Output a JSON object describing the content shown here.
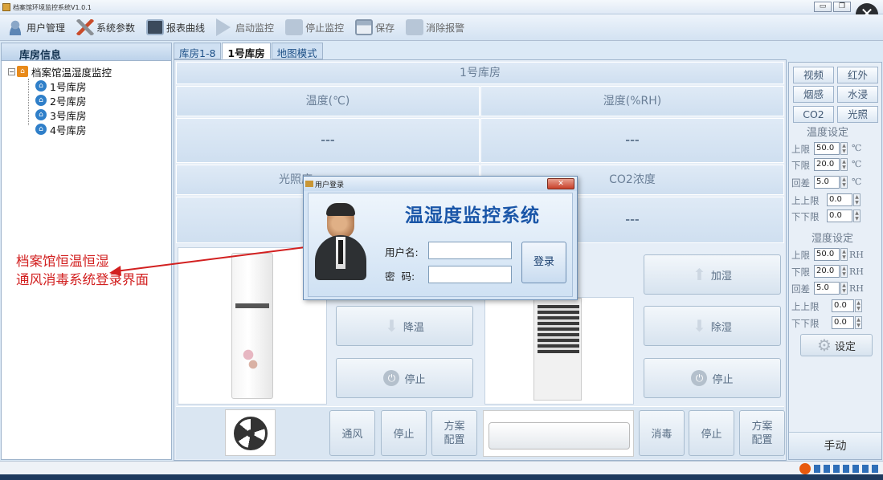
{
  "window": {
    "title": "档案馆环境监控系统V1.0.1"
  },
  "toolbar": {
    "items": [
      {
        "label": "用户管理",
        "icon": "user-icon"
      },
      {
        "label": "系统参数",
        "icon": "tools-icon"
      },
      {
        "label": "报表曲线",
        "icon": "chart-icon"
      },
      {
        "label": "启动监控",
        "icon": "play-icon"
      },
      {
        "label": "停止监控",
        "icon": "stop-icon"
      },
      {
        "label": "保存",
        "icon": "save-icon"
      },
      {
        "label": "消除报警",
        "icon": "clear-alarm-icon"
      }
    ]
  },
  "sidebar": {
    "title": "库房信息",
    "root": "档案馆温湿度监控",
    "rooms": [
      "1号库房",
      "2号库房",
      "3号库房",
      "4号库房"
    ]
  },
  "tabs": [
    "库房1-8",
    "1号库房",
    "地图模式"
  ],
  "main": {
    "room_title": "1号库房",
    "temp_label": "温度(℃)",
    "humidity_label": "湿度(%RH)",
    "temp_value": "---",
    "humidity_value": "---",
    "light_label": "光照度",
    "co2_label": "CO2浓度",
    "co2_value": "---",
    "cool_btn": "降温",
    "stop1": "停止",
    "humidify_btn": "加湿",
    "dehumidify_btn": "除湿",
    "stop2": "停止",
    "vent_btn": "通风",
    "stop3": "停止",
    "plan1": "方案\n配置",
    "disinfect_btn": "消毒",
    "stop4": "停止",
    "plan2": "方案\n配置"
  },
  "right": {
    "sensor_btns": [
      "视频",
      "红外",
      "烟感",
      "水浸",
      "CO2",
      "光照"
    ],
    "temp_set_title": "温度设定",
    "upper": "上限",
    "lower": "下限",
    "diff": "回差",
    "upper_upper": "上上限",
    "lower_lower": "下下限",
    "temp_upper": "50.0",
    "temp_lower": "20.0",
    "temp_diff": "5.0",
    "temp_uu": "0.0",
    "temp_ll": "0.0",
    "unit_c": "℃",
    "hum_set_title": "湿度设定",
    "hum_upper": "50.0",
    "hum_lower": "20.0",
    "hum_diff": "5.0",
    "hum_uu": "0.0",
    "hum_ll": "0.0",
    "unit_rh": "RH",
    "set_btn": "设定",
    "manual": "手动"
  },
  "dialog": {
    "title": "用户登录",
    "heading": "温湿度监控系统",
    "user_label": "用户名:",
    "pwd_label": "密  码:",
    "login": "登录"
  },
  "annotation": {
    "line1": "档案馆恒温恒湿",
    "line2": "通风消毒系统登录界面"
  },
  "colors": {
    "accent": "#1a56a8",
    "annotation": "#d22020"
  }
}
